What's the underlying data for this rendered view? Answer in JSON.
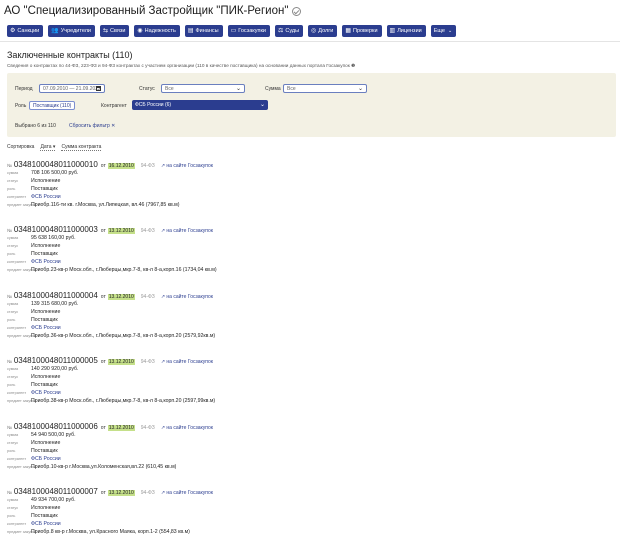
{
  "header": {
    "title": "АО \"Специализированный Застройщик \"ПИК-Регион\""
  },
  "nav": [
    {
      "icon": "⚙",
      "label": "Санкции"
    },
    {
      "icon": "👥",
      "label": "Учредители"
    },
    {
      "icon": "⇆",
      "label": "Связи"
    },
    {
      "icon": "◉",
      "label": "Надежность"
    },
    {
      "icon": "▤",
      "label": "Финансы"
    },
    {
      "icon": "▭",
      "label": "Госзакупки"
    },
    {
      "icon": "⚖",
      "label": "Суды"
    },
    {
      "icon": "◎",
      "label": "Долги"
    },
    {
      "icon": "▦",
      "label": "Проверки"
    },
    {
      "icon": "▥",
      "label": "Лицензии"
    },
    {
      "icon": "",
      "label": "Еще",
      "chevron": "⌄"
    }
  ],
  "section": {
    "title": "Заключенные контракты (110)",
    "subtitle": "Сведения о контрактах по 44-ФЗ, 223-ФЗ и 94-ФЗ контрактах с участием организации (110 в качестве поставщика) на основании данных портала Госзакупок ❶"
  },
  "filters": {
    "period_label": "Период",
    "period_value": "07.09.2010 — 21.09.2022",
    "status_label": "Статус",
    "status_value": "Все",
    "sum_label": "Сумма",
    "sum_value": "Все",
    "role_label": "Роль",
    "role_value": "Поставщик (110)",
    "counterparty_label": "Контрагент",
    "counterparty_value": "ФСБ России (6)",
    "selected_text": "Выбрано 6 из 110",
    "reset_link": "Сбросить фильтр ✕"
  },
  "sort": {
    "label": "Сортировка",
    "by_date": "Дата ▾",
    "by_sum": "Сумма контракта"
  },
  "contracts": [
    {
      "prefix": "№",
      "number": "0348100048011000010",
      "from": "от",
      "date": "16.12.2010",
      "law": "94-ФЗ",
      "site_link": "↗ на сайте Госзакупок",
      "sum_label": "сумма",
      "sum": "708 106 500,00 руб.",
      "status_label": "статус",
      "status": "Исполнение",
      "role_label": "роль",
      "role": "Поставщик",
      "counterparty_label": "контрагент",
      "counterparty": "ФСБ России",
      "subject_label": "предмет закупки",
      "subject": "Приобр.116-ти кв. г.Москва, ул.Липецкая, вл.46 (7967,85 кв.м)"
    },
    {
      "prefix": "№",
      "number": "0348100048011000003",
      "from": "от",
      "date": "13.12.2010",
      "law": "94-ФЗ",
      "site_link": "↗ на сайте Госзакупок",
      "sum_label": "сумма",
      "sum": "95 638 160,00 руб.",
      "status_label": "статус",
      "status": "Исполнение",
      "role_label": "роль",
      "role": "Поставщик",
      "counterparty_label": "контрагент",
      "counterparty": "ФСБ России",
      "subject_label": "предмет закупки",
      "subject": "Приобр.23-кв-р Моск.обл., г.Люберцы,мкр.7-8, кв-л 8-а,корп.16 (1734,04 кв.м)"
    },
    {
      "prefix": "№",
      "number": "0348100048011000004",
      "from": "от",
      "date": "13.12.2010",
      "law": "94-ФЗ",
      "site_link": "↗ на сайте Госзакупок",
      "sum_label": "сумма",
      "sum": "139 315 680,00 руб.",
      "status_label": "статус",
      "status": "Исполнение",
      "role_label": "роль",
      "role": "Поставщик",
      "counterparty_label": "контрагент",
      "counterparty": "ФСБ России",
      "subject_label": "предмет закупки",
      "subject": "Приобр.36-кв-р Моск.обл., г.Люберцы,мкр.7-8, кв-л 8-а,корп.20 (2579,92кв.м)"
    },
    {
      "prefix": "№",
      "number": "0348100048011000005",
      "from": "от",
      "date": "13.12.2010",
      "law": "94-ФЗ",
      "site_link": "↗ на сайте Госзакупок",
      "sum_label": "сумма",
      "sum": "140 290 920,00 руб.",
      "status_label": "статус",
      "status": "Исполнение",
      "role_label": "роль",
      "role": "Поставщик",
      "counterparty_label": "контрагент",
      "counterparty": "ФСБ России",
      "subject_label": "предмет закупки",
      "subject": "Приобр.38-кв-р Моск.обл., г.Люберцы,мкр.7-8, кв-л 8-а,корп.20 (2597,99кв.м)"
    },
    {
      "prefix": "№",
      "number": "0348100048011000006",
      "from": "от",
      "date": "13.12.2010",
      "law": "94-ФЗ",
      "site_link": "↗ на сайте Госзакупок",
      "sum_label": "сумма",
      "sum": "54 940 500,00 руб.",
      "status_label": "статус",
      "status": "Исполнение",
      "role_label": "роль",
      "role": "Поставщик",
      "counterparty_label": "контрагент",
      "counterparty": "ФСБ России",
      "subject_label": "предмет закупки",
      "subject": "Приобр.10-кв-р г.Москва,ул.Коломенская,вл.22 (610,45 кв.м)"
    },
    {
      "prefix": "№",
      "number": "0348100048011000007",
      "from": "от",
      "date": "13.12.2010",
      "law": "94-ФЗ",
      "site_link": "↗ на сайте Госзакупок",
      "sum_label": "сумма",
      "sum": "49 934 700,00 руб.",
      "status_label": "статус",
      "status": "Исполнение",
      "role_label": "роль",
      "role": "Поставщик",
      "counterparty_label": "контрагент",
      "counterparty": "ФСБ России",
      "subject_label": "предмет закупки",
      "subject": "Приобр.8 кв-р г.Москва, ул.Красного Маяка, корп.1-2 (554,83 кв.м)"
    }
  ]
}
